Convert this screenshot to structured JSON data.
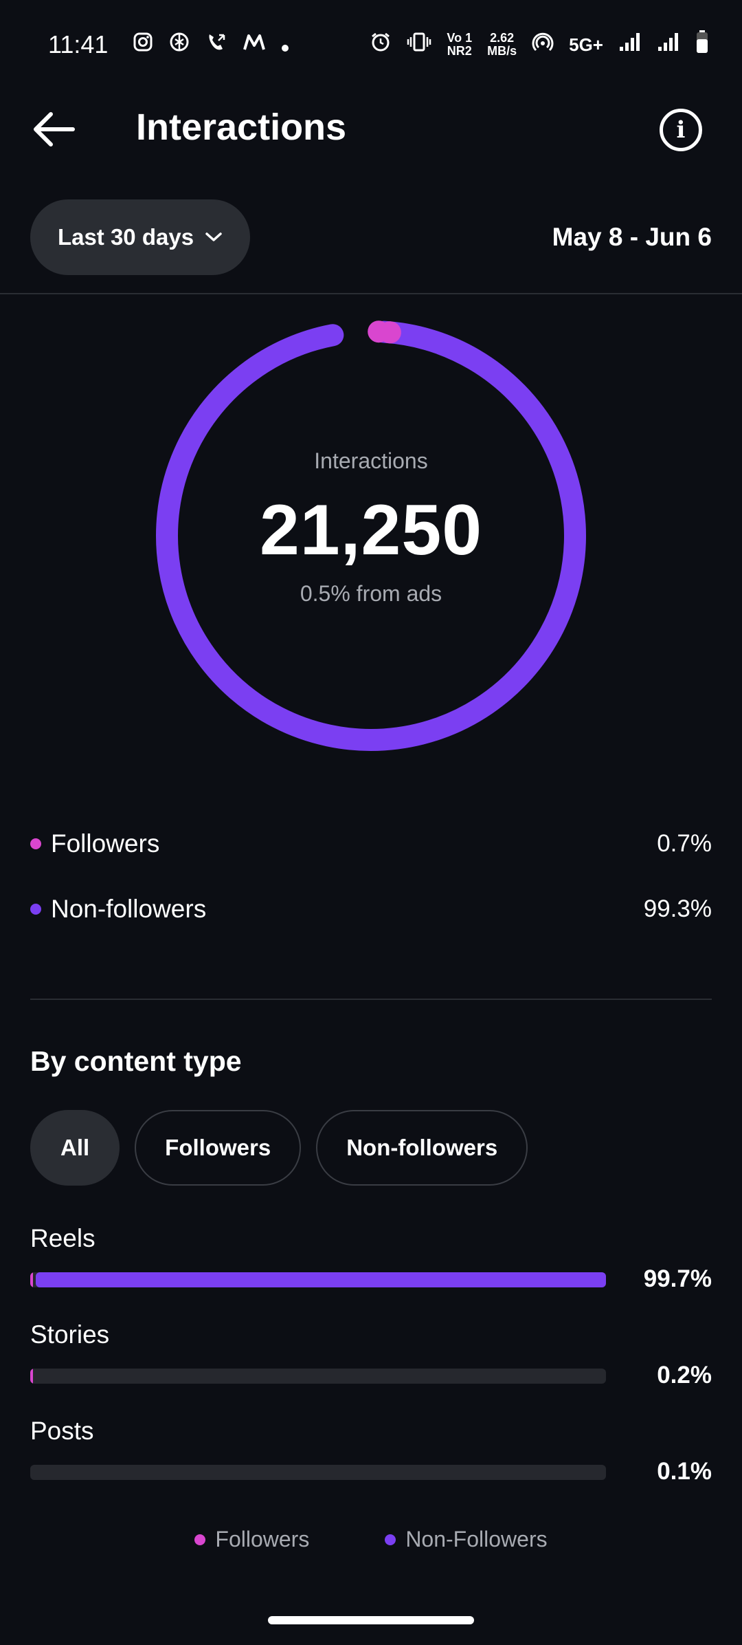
{
  "status_bar": {
    "time": "11:41",
    "net_speed_value": "2.62",
    "net_speed_unit": "MB/s",
    "volte_top": "Vo 1",
    "volte_bottom": "NR2",
    "network": "5G+"
  },
  "header": {
    "title": "Interactions"
  },
  "range": {
    "selected_label": "Last 30 days",
    "date_range": "May 8 - Jun 6"
  },
  "summary": {
    "label": "Interactions",
    "total": "21,250",
    "ads_note": "0.5% from ads",
    "followers_fraction": 0.007,
    "nonfollowers_fraction": 0.993
  },
  "audience": [
    {
      "label": "Followers",
      "percent": "0.7%",
      "color": "#d946cf"
    },
    {
      "label": "Non-followers",
      "percent": "99.3%",
      "color": "#7b3ff2"
    }
  ],
  "content_type": {
    "title": "By content type",
    "filters": [
      {
        "label": "All",
        "active": true
      },
      {
        "label": "Followers",
        "active": false
      },
      {
        "label": "Non-followers",
        "active": false
      }
    ],
    "rows": [
      {
        "label": "Reels",
        "percent": "99.7%",
        "followers_fraction": 0.005,
        "nonfollowers_fraction": 0.992
      },
      {
        "label": "Stories",
        "percent": "0.2%",
        "followers_fraction": 0.002,
        "nonfollowers_fraction": 0.0
      },
      {
        "label": "Posts",
        "percent": "0.1%",
        "followers_fraction": 0.0,
        "nonfollowers_fraction": 0.0
      }
    ]
  },
  "bottom_legend": [
    {
      "label": "Followers",
      "color": "#d946cf"
    },
    {
      "label": "Non-Followers",
      "color": "#7b3ff2"
    }
  ],
  "colors": {
    "followers": "#d946cf",
    "nonfollowers": "#7b3ff2",
    "track": "#26282e",
    "background": "#0c0e14"
  }
}
